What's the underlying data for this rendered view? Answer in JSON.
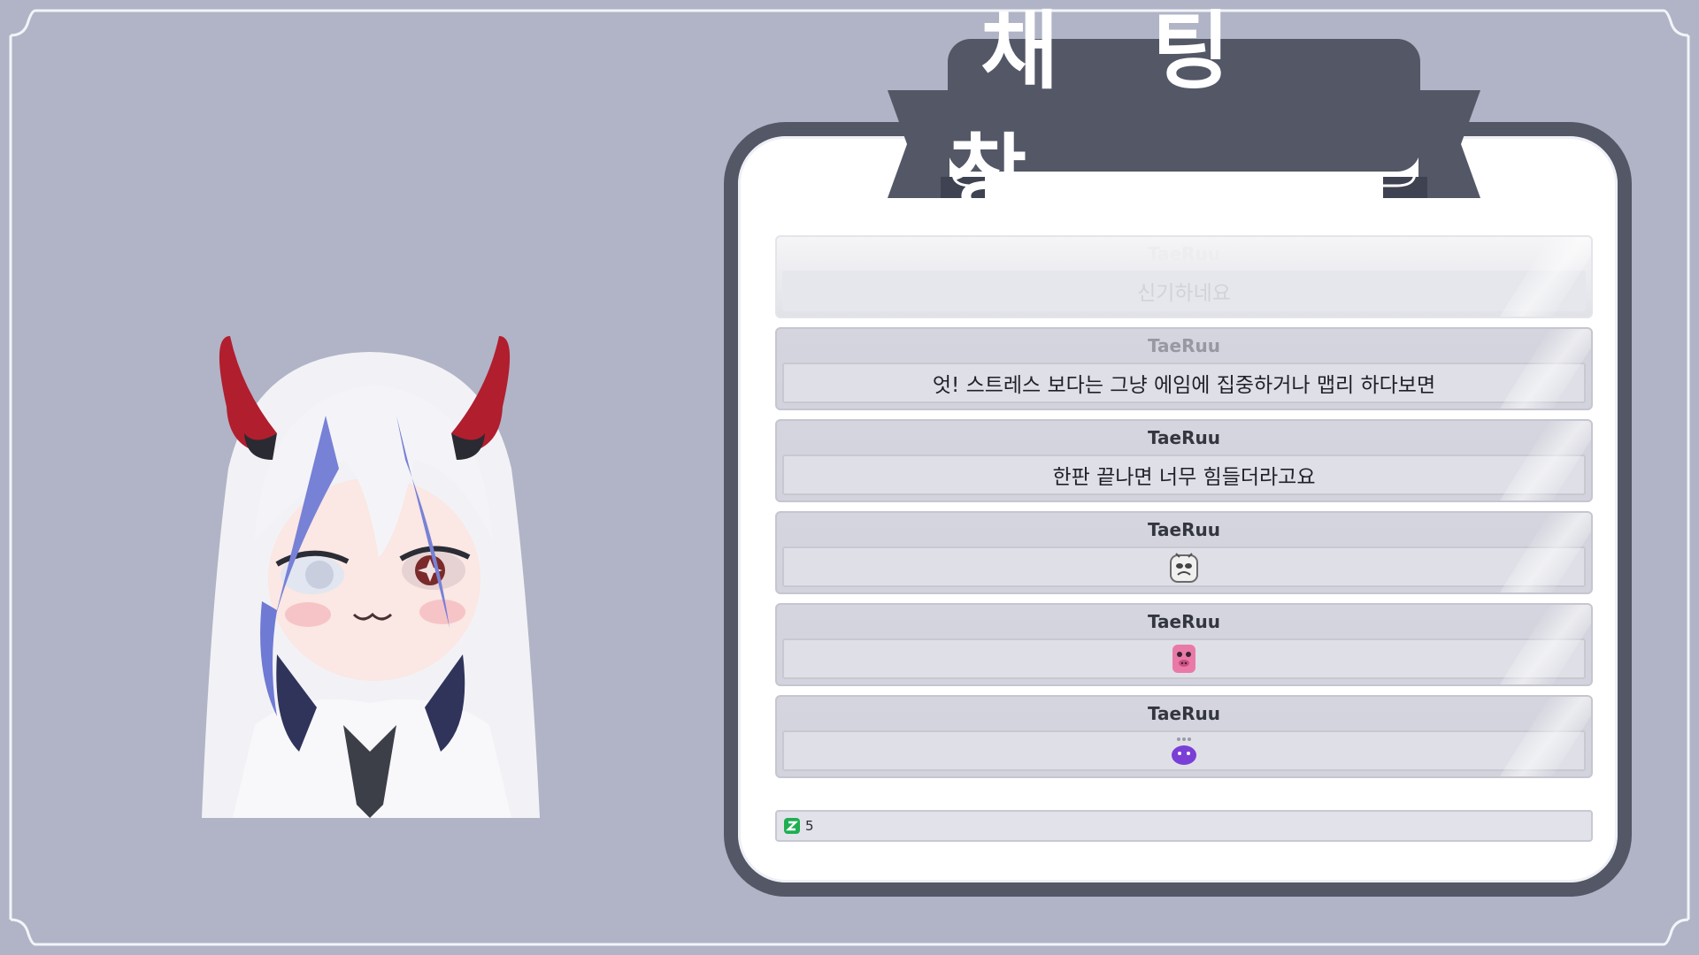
{
  "banner": {
    "title": "채 팅 창"
  },
  "messages": [
    {
      "user": "TaeRuu",
      "text": "신기하네요",
      "emote": "",
      "state": "faded"
    },
    {
      "user": "TaeRuu",
      "text": "엇! 스트레스 보다는 그냥 에임에 집중하거나 맵리 하다보면",
      "emote": "",
      "state": "semi"
    },
    {
      "user": "TaeRuu",
      "text": "한판 끝나면 너무 힘들더라고요",
      "emote": "",
      "state": "normal"
    },
    {
      "user": "TaeRuu",
      "text": "",
      "emote": "crying-face-emote-icon",
      "state": "normal"
    },
    {
      "user": "TaeRuu",
      "text": "",
      "emote": "pink-pig-emote-icon",
      "state": "normal"
    },
    {
      "user": "TaeRuu",
      "text": "",
      "emote": "purple-blob-emote-icon",
      "state": "normal"
    }
  ],
  "viewers": {
    "count": "5",
    "icon": "viewer-count-icon"
  },
  "colors": {
    "background": "#b0b4c6",
    "frame_dark": "#535766",
    "card": "#ffffff",
    "message_bg": "#d4d5de"
  }
}
